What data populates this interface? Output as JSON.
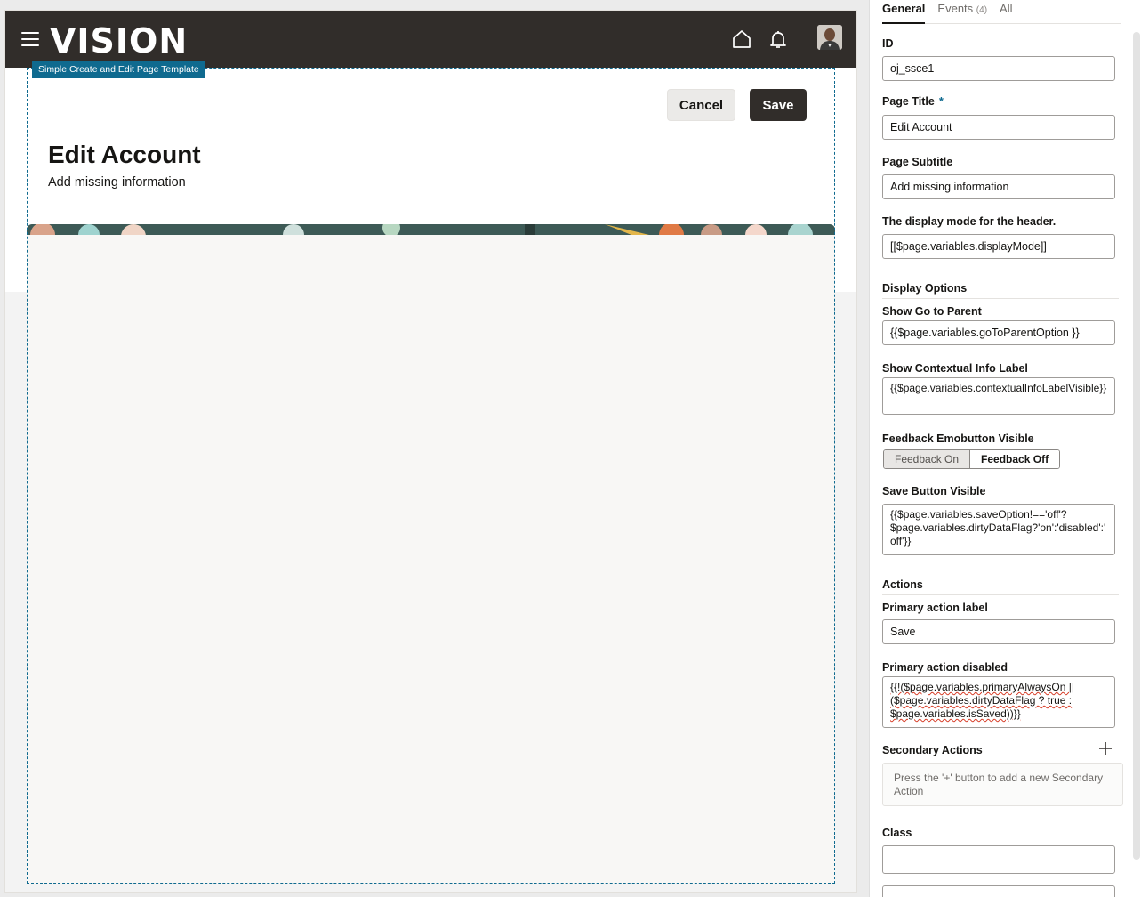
{
  "app": {
    "logo": "VISION",
    "template_label": "Simple Create and Edit Page Template",
    "cancel_label": "Cancel",
    "save_label": "Save",
    "page_title": "Edit Account",
    "page_subtitle": "Add missing information",
    "icons": [
      "menu-icon",
      "home-icon",
      "bell-icon",
      "avatar"
    ],
    "colors": {
      "header_bg": "#312d2a",
      "selection_accent": "#0f6a8f",
      "primary_button": "#312d2a"
    }
  },
  "inspector": {
    "tabs": [
      {
        "label": "General",
        "count": ""
      },
      {
        "label": "Events",
        "count": "(4)"
      },
      {
        "label": "All",
        "count": ""
      }
    ],
    "id_label": "ID",
    "id_value": "oj_ssce1",
    "page_title_label": "Page Title",
    "page_title_required": "*",
    "page_title_value": "Edit Account",
    "page_subtitle_label": "Page Subtitle",
    "page_subtitle_value": "Add missing information",
    "display_mode_label": "The display mode for the header.",
    "display_mode_value": "[[$page.variables.displayMode]]",
    "display_options_header": "Display Options",
    "go_to_parent_label": "Show Go to Parent",
    "go_to_parent_value": "{{$page.variables.goToParentOption }}",
    "contextual_info_label": "Show Contextual Info Label",
    "contextual_info_value": "{{$page.variables.contextualInfoLabelVisible}}",
    "feedback_label": "Feedback Emobutton Visible",
    "feedback_on": "Feedback On",
    "feedback_off": "Feedback Off",
    "save_visible_label": "Save Button Visible",
    "save_visible_value": "{{$page.variables.saveOption!=='off'?$page.variables.dirtyDataFlag?'on':'disabled':'off'}}",
    "actions_header": "Actions",
    "primary_action_label": "Primary action label",
    "primary_action_value": "Save",
    "primary_disabled_label": "Primary action disabled",
    "primary_disabled_value": "{{!($page.variables.primaryAlwaysOn ||($page.variables.dirtyDataFlag ? true : $page.variables.isSaved))}}",
    "secondary_actions_label": "Secondary Actions",
    "secondary_actions_hint": "Press the '+' button to add a new Secondary Action",
    "class_label": "Class",
    "class_value": ""
  }
}
